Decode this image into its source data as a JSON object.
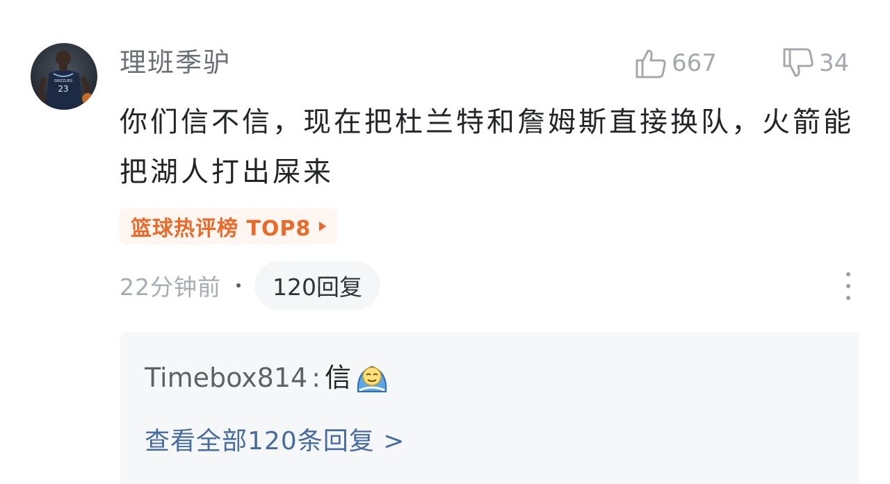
{
  "comment": {
    "username": "理班季驴",
    "likes": "667",
    "dislikes": "34",
    "text": "你们信不信，现在把杜兰特和詹姆斯直接换队，火箭能把湖人打出屎来",
    "badge": "篮球热评榜 TOP8",
    "time": "22分钟前",
    "separator": "·",
    "reply_count_label": "120回复",
    "avatar_icon": "player-avatar-icon",
    "like_icon": "thumbs-up-icon",
    "dislike_icon": "thumbs-down-icon",
    "more_icon": "more-vertical-icon"
  },
  "reply_preview": {
    "author": "Timebox814",
    "colon": ":",
    "text": "信",
    "emoji_icon": "smug-emoji-icon",
    "view_all": "查看全部120条回复 >"
  },
  "colors": {
    "badge": "#ea6a2a",
    "link": "#466b9f",
    "muted": "#a7abb2",
    "reply_bg": "#f6f7f9"
  }
}
